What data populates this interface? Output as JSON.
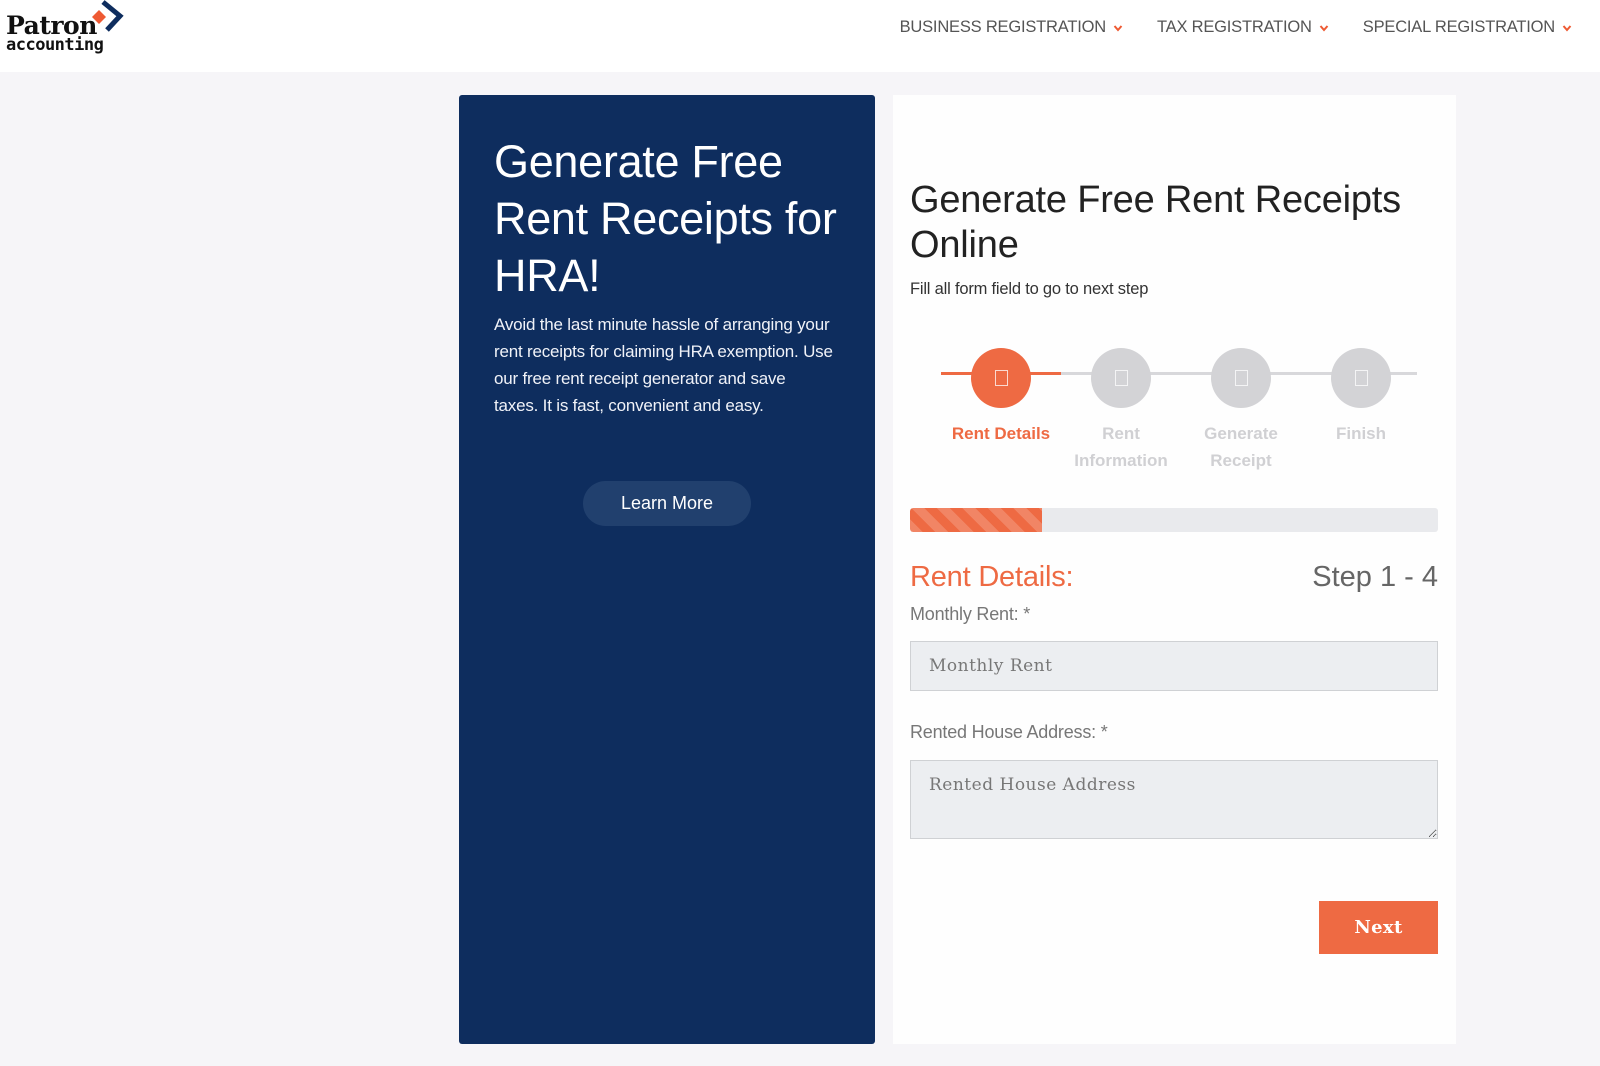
{
  "header": {
    "logo": {
      "line1": "Patron",
      "line2": "accounting"
    },
    "nav": [
      {
        "label": "BUSINESS REGISTRATION",
        "icon": "chevron-down-icon"
      },
      {
        "label": "TAX REGISTRATION",
        "icon": "chevron-down-icon"
      },
      {
        "label": "SPECIAL REGISTRATION",
        "icon": "chevron-down-icon"
      }
    ]
  },
  "promo": {
    "title": "Generate Free Rent Receipts for HRA!",
    "text": "Avoid the last minute hassle of arranging your rent receipts for claiming HRA exemption. Use our free rent receipt generator and save taxes. It is fast, convenient and easy.",
    "button_label": "Learn More"
  },
  "form": {
    "title": "Generate Free Rent Receipts Online",
    "subtitle": "Fill all form field to go to next step",
    "steps": [
      {
        "label": "Rent Details",
        "active": true
      },
      {
        "label": "Rent Information",
        "active": false
      },
      {
        "label": "Generate Receipt",
        "active": false
      },
      {
        "label": "Finish",
        "active": false
      }
    ],
    "progress_percent": 25,
    "section_title": "Rent Details:",
    "step_count": "Step 1 - 4",
    "fields": {
      "monthly_rent": {
        "label": "Monthly Rent: *",
        "placeholder": "Monthly Rent",
        "value": ""
      },
      "address": {
        "label": "Rented House Address: *",
        "placeholder": "Rented House Address",
        "value": ""
      }
    },
    "next_label": "Next"
  },
  "colors": {
    "accent": "#ee6a43",
    "navy": "#0e2d5e",
    "inactive_step": "#d3d3d6",
    "inactive_text": "#d0d0d3"
  }
}
